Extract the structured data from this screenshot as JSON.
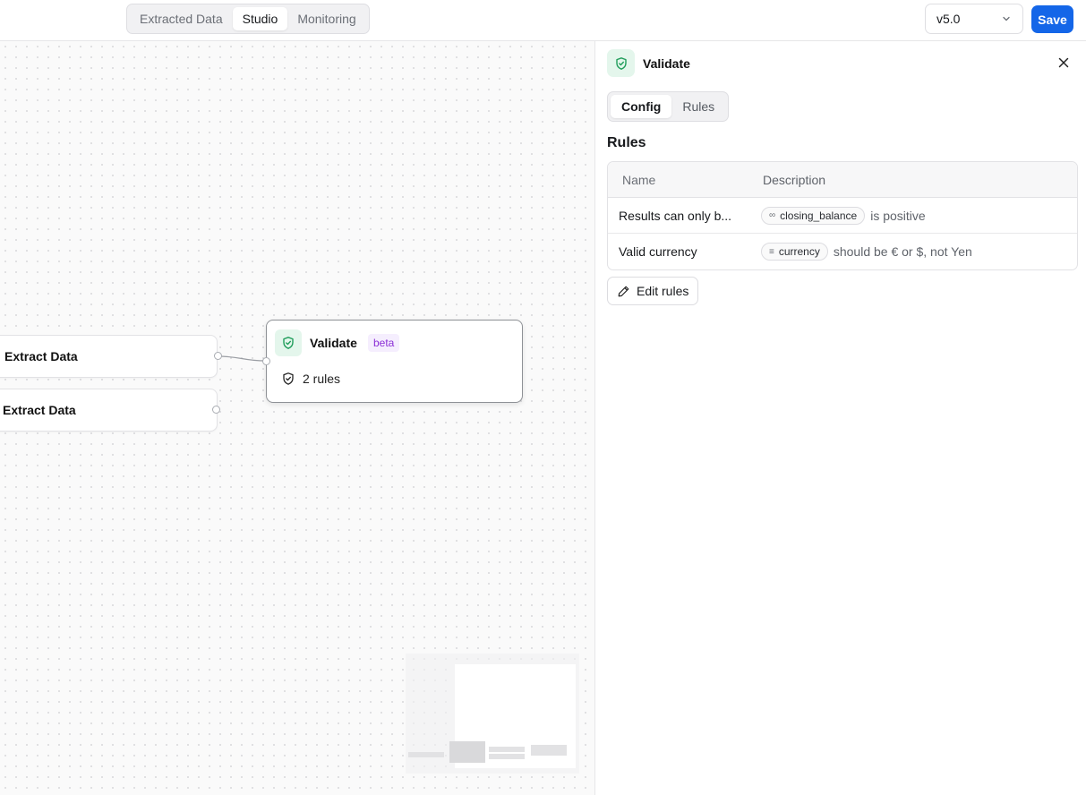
{
  "topbar": {
    "tabs": [
      {
        "label": "Extracted Data"
      },
      {
        "label": "Studio"
      },
      {
        "label": "Monitoring"
      }
    ],
    "active_tab": "Studio",
    "version": "v5.0",
    "save_label": "Save"
  },
  "canvas": {
    "nodes": [
      {
        "label": "Extract Data"
      },
      {
        "label": "Extract Data"
      }
    ],
    "validate_node": {
      "title": "Validate",
      "badge": "beta",
      "rules_count_label": "2 rules"
    }
  },
  "panel": {
    "title": "Validate",
    "tabs": [
      {
        "label": "Config"
      },
      {
        "label": "Rules"
      }
    ],
    "active_tab": "Config",
    "section_title": "Rules",
    "table": {
      "headers": [
        "Name",
        "Description"
      ],
      "rows": [
        {
          "name": "Results can only b...",
          "field": "closing_balance",
          "field_icon": "∞",
          "text": "is positive"
        },
        {
          "name": "Valid currency",
          "field": "currency",
          "field_icon": "≡",
          "text": "should be € or $, not Yen"
        }
      ]
    },
    "edit_label": "Edit rules"
  },
  "colors": {
    "accent": "#1466e8",
    "success_bg": "#e4f6ec",
    "success_icon": "#1f9d5a",
    "beta_text": "#8b2fd6",
    "beta_bg": "#f5eefe"
  },
  "icons": {
    "shield": "shield-check-icon",
    "close": "close-icon",
    "chevron": "chevron-down-icon",
    "pencil": "pencil-icon",
    "rules": "shield-icon"
  }
}
